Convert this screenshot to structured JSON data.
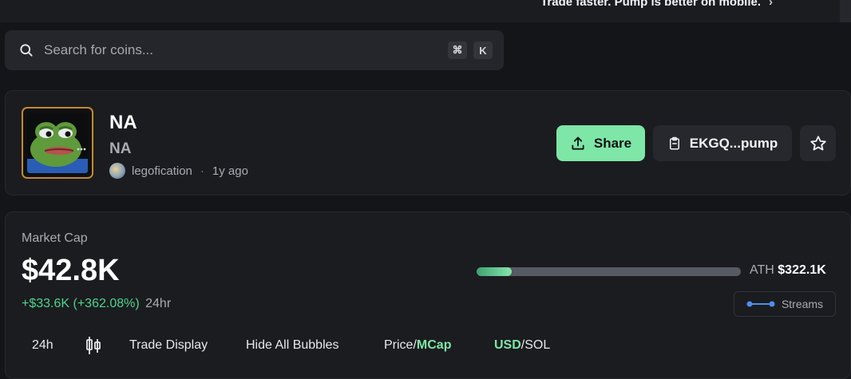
{
  "banner": {
    "text": "Trade faster. Pump is better on mobile.",
    "chevron": "›"
  },
  "search": {
    "placeholder": "Search for coins...",
    "shortcut_key1": "⌘",
    "shortcut_key2": "K"
  },
  "token": {
    "name": "NA",
    "symbol": "NA",
    "creator": "legofication",
    "separator": "·",
    "age": "1y ago",
    "avatar_icon": "frog-image"
  },
  "actions": {
    "share_label": "Share",
    "contract_label": "EKGQ...pump"
  },
  "market": {
    "label": "Market Cap",
    "value": "$42.8K",
    "change": "+$33.6K (+362.08%)",
    "period": "24hr",
    "ath_label": "ATH",
    "ath_value": "$322.1K",
    "ath_progress": 0.133,
    "streams_label": "Streams"
  },
  "toolbar": {
    "timeframe": "24h",
    "trade_display": "Trade Display",
    "hide_bubbles": "Hide All Bubbles",
    "price": "Price",
    "slash1": "/",
    "mcap": "MCap",
    "usd": "USD",
    "slash2": "/",
    "sol": "SOL"
  },
  "colors": {
    "accent": "#7ee6a6",
    "positive": "#4fd48a",
    "background": "#141518",
    "card": "#1b1c20"
  }
}
